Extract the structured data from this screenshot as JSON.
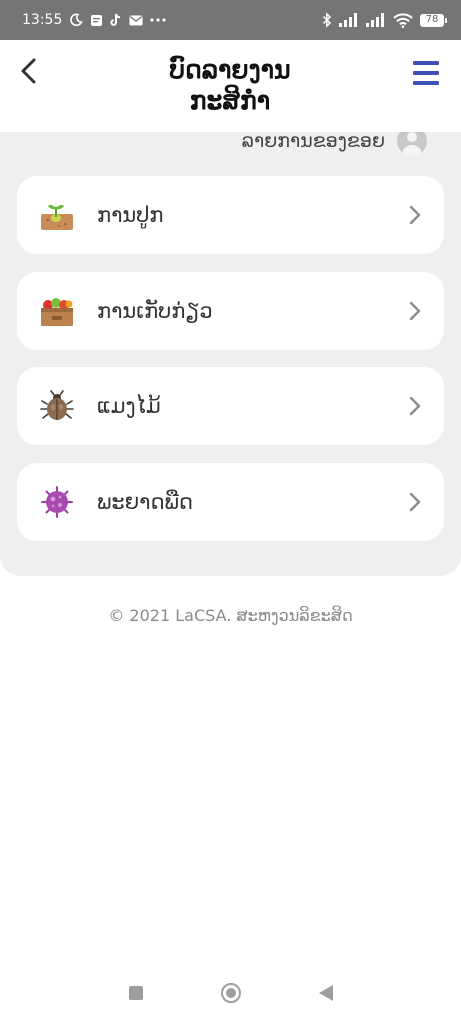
{
  "status_bar": {
    "time": "13:55",
    "battery": "78",
    "left_icons": [
      "moon-icon",
      "notes-icon",
      "tiktok-icon",
      "mail-icon",
      "more-dots-icon"
    ],
    "right_icons": [
      "bluetooth-icon",
      "signal-icon",
      "signal-icon",
      "wifi-icon",
      "battery-icon"
    ]
  },
  "header": {
    "title_line1": "ບົດລາຍງານ",
    "title_line2": "ກະສິກຳ",
    "back_icon": "chevron-left-icon",
    "menu_icon": "hamburger-menu-icon",
    "accent_color": "#3f51b5"
  },
  "my_list": {
    "label": "ລາຍການຂອງຂອຍ",
    "icon": "user-avatar-icon"
  },
  "menu_items": [
    {
      "label": "ການປູກ",
      "icon": "seedling-soil-icon"
    },
    {
      "label": "ການເກັບກ່ຽວ",
      "icon": "harvest-crate-icon"
    },
    {
      "label": "ແມງໄມ້",
      "icon": "beetle-icon"
    },
    {
      "label": "ພະຍາດພືດ",
      "icon": "virus-icon"
    }
  ],
  "footer": {
    "text": "© 2021 LaCSA. ສະຫງວນລິຂະສິດ"
  },
  "nav_bar": {
    "buttons": [
      "recents-square-icon",
      "home-circle-icon",
      "back-triangle-icon"
    ]
  }
}
